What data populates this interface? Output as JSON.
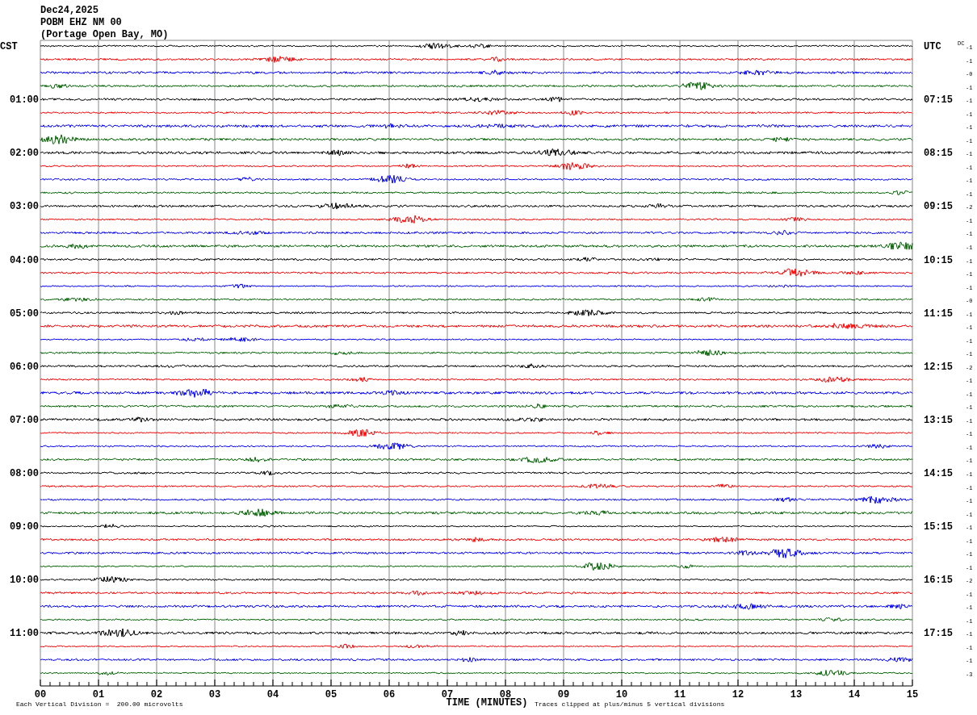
{
  "header": {
    "date": "Dec24,2025",
    "station": "POBM EHZ NM 00",
    "location": "(Portage Open Bay, MO)"
  },
  "left_timezone": "CST",
  "right_timezone": "UTC",
  "dc_header": "DC",
  "traces": [
    {
      "dc": "-1",
      "color": "#000000"
    },
    {
      "dc": "-1",
      "color": "#ff0000"
    },
    {
      "dc": "-0",
      "color": "#0000ff"
    },
    {
      "dc": "-1",
      "color": "#006400"
    },
    {
      "left_label": "01:00",
      "right_label": "07:15",
      "dc": "-1",
      "color": "#000000"
    },
    {
      "dc": "-1",
      "color": "#ff0000"
    },
    {
      "dc": "-1",
      "color": "#0000ff"
    },
    {
      "dc": "-1",
      "color": "#006400"
    },
    {
      "left_label": "02:00",
      "right_label": "08:15",
      "dc": "-1",
      "color": "#000000"
    },
    {
      "dc": "-1",
      "color": "#ff0000"
    },
    {
      "dc": "-1",
      "color": "#0000ff"
    },
    {
      "dc": "-1",
      "color": "#006400"
    },
    {
      "left_label": "03:00",
      "right_label": "09:15",
      "dc": "-2",
      "color": "#000000"
    },
    {
      "dc": "-1",
      "color": "#ff0000"
    },
    {
      "dc": "-1",
      "color": "#0000ff"
    },
    {
      "dc": "-1",
      "color": "#006400"
    },
    {
      "left_label": "04:00",
      "right_label": "10:15",
      "dc": "-1",
      "color": "#000000"
    },
    {
      "dc": "-1",
      "color": "#ff0000"
    },
    {
      "dc": "-1",
      "color": "#0000ff"
    },
    {
      "dc": "-0",
      "color": "#006400"
    },
    {
      "left_label": "05:00",
      "right_label": "11:15",
      "dc": "-1",
      "color": "#000000"
    },
    {
      "dc": "-1",
      "color": "#ff0000"
    },
    {
      "dc": "-1",
      "color": "#0000ff"
    },
    {
      "dc": "-1",
      "color": "#006400"
    },
    {
      "left_label": "06:00",
      "right_label": "12:15",
      "dc": "-2",
      "color": "#000000"
    },
    {
      "dc": "-1",
      "color": "#ff0000"
    },
    {
      "dc": "-1",
      "color": "#0000ff"
    },
    {
      "dc": "-1",
      "color": "#006400"
    },
    {
      "left_label": "07:00",
      "right_label": "13:15",
      "dc": "-1",
      "color": "#000000"
    },
    {
      "dc": "-1",
      "color": "#ff0000"
    },
    {
      "dc": "-1",
      "color": "#0000ff"
    },
    {
      "dc": "-1",
      "color": "#006400"
    },
    {
      "left_label": "08:00",
      "right_label": "14:15",
      "dc": "-1",
      "color": "#000000"
    },
    {
      "dc": "-1",
      "color": "#ff0000"
    },
    {
      "dc": "-1",
      "color": "#0000ff"
    },
    {
      "dc": "-1",
      "color": "#006400"
    },
    {
      "left_label": "09:00",
      "right_label": "15:15",
      "dc": "-1",
      "color": "#000000"
    },
    {
      "dc": "-1",
      "color": "#ff0000"
    },
    {
      "dc": "-1",
      "color": "#0000ff"
    },
    {
      "dc": "-1",
      "color": "#006400"
    },
    {
      "left_label": "10:00",
      "right_label": "16:15",
      "dc": "-2",
      "color": "#000000"
    },
    {
      "dc": "-1",
      "color": "#ff0000"
    },
    {
      "dc": "-1",
      "color": "#0000ff"
    },
    {
      "dc": "-1",
      "color": "#006400"
    },
    {
      "left_label": "11:00",
      "right_label": "17:15",
      "dc": "-1",
      "color": "#000000"
    },
    {
      "dc": "-1",
      "color": "#ff0000"
    },
    {
      "dc": "-1",
      "color": "#0000ff"
    },
    {
      "dc": "-3",
      "color": "#006400"
    }
  ],
  "x_axis": {
    "title": "TIME (MINUTES)",
    "tick_labels": [
      "00",
      "01",
      "02",
      "03",
      "04",
      "05",
      "06",
      "07",
      "08",
      "09",
      "10",
      "11",
      "12",
      "13",
      "14",
      "15"
    ]
  },
  "footer": {
    "scale_note": "Each Vertical Division =  200.00 microvolts",
    "clip_note": "Traces clipped at plus/minus 5 vertical divisions"
  }
}
